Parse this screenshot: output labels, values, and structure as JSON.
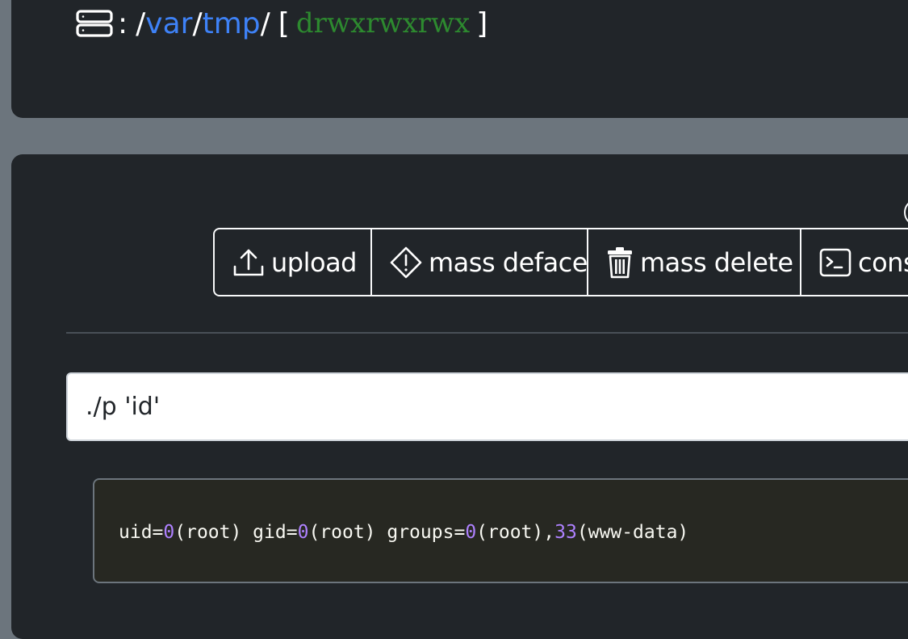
{
  "path": {
    "icon": "server-icon",
    "colon": ":",
    "root_sep": "/",
    "segments": [
      "var",
      "tmp"
    ],
    "trailing_sep": "/",
    "perm_open": "[",
    "permissions": "drwxrwxrwx",
    "perm_close": "]"
  },
  "toolbar": {
    "upload_label": "upload",
    "deface_label": "mass deface",
    "delete_label": "mass delete",
    "console_label": "cons"
  },
  "command": {
    "value": "./p 'id'"
  },
  "output": {
    "parts": [
      {
        "t": "uid=",
        "num": false
      },
      {
        "t": "0",
        "num": true
      },
      {
        "t": "(root) gid=",
        "num": false
      },
      {
        "t": "0",
        "num": true
      },
      {
        "t": "(root) groups=",
        "num": false
      },
      {
        "t": "0",
        "num": true
      },
      {
        "t": "(root),",
        "num": false
      },
      {
        "t": "33",
        "num": true
      },
      {
        "t": "(www-data)",
        "num": false
      }
    ]
  },
  "colors": {
    "background": "#6c757d",
    "card": "#212529",
    "link": "#3e82f7",
    "permission": "#2d8a2f",
    "number": "#ae81ff"
  }
}
